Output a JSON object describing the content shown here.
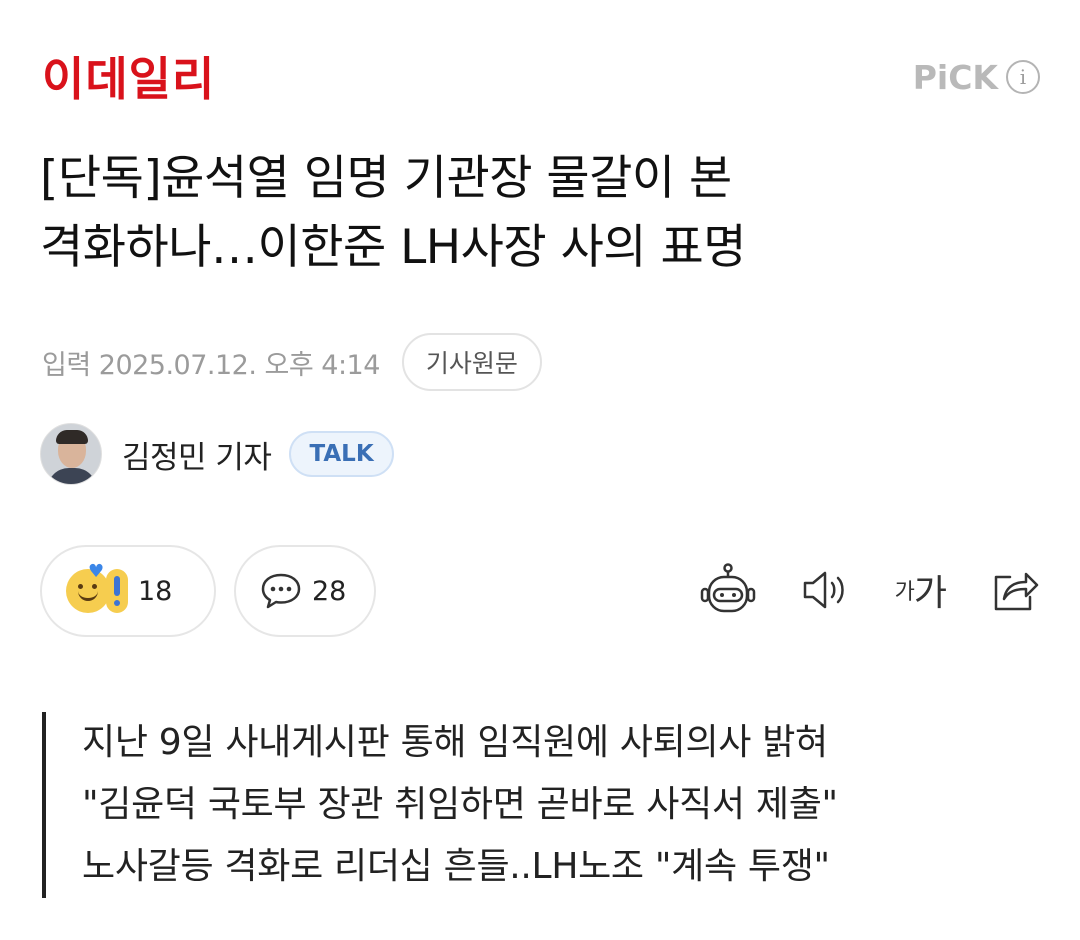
{
  "header": {
    "logo_text": "이데일리",
    "pick_label": "PiCK",
    "info_icon": "i",
    "brand_color": "#d9121b"
  },
  "article": {
    "title_line1": "[단독]윤석열 임명 기관장 물갈이 본",
    "title_line2": "격화하나…이한준 LH사장 사의 표명",
    "date_text": "입력 2025.07.12. 오후 4:14",
    "original_button": "기사원문"
  },
  "author": {
    "name": "김정민 기자",
    "talk_button": "TALK"
  },
  "actions": {
    "reaction_count": "18",
    "comment_count": "28",
    "tools": [
      "robot-icon",
      "speaker-icon",
      "font-size-icon",
      "share-icon"
    ],
    "font_small": "가",
    "font_big": "가"
  },
  "summary": {
    "lines": [
      "지난 9일 사내게시판 통해 임직원에 사퇴의사 밝혀",
      "\"김윤덕 국토부 장관 취임하면 곧바로 사직서 제출\"",
      "노사갈등 격화로 리더십 흔들..LH노조 \"계속 투쟁\""
    ]
  }
}
